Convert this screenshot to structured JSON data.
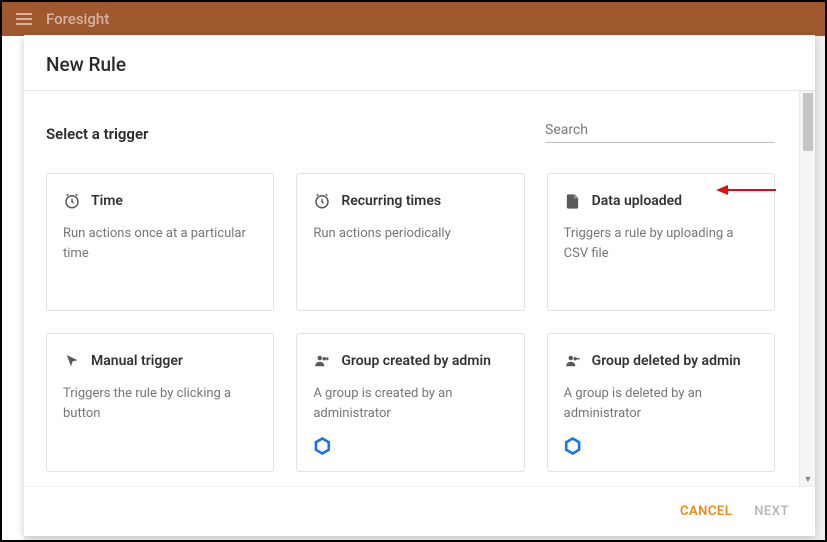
{
  "brand": "Foresight",
  "modal": {
    "title": "New Rule",
    "subheader": "Select a trigger",
    "search_placeholder": "Search"
  },
  "triggers": [
    {
      "title": "Time",
      "desc": "Run actions once at a particular time",
      "icon": "clock-icon"
    },
    {
      "title": "Recurring times",
      "desc": "Run actions periodically",
      "icon": "clock-icon"
    },
    {
      "title": "Data uploaded",
      "desc": "Triggers a rule by uploading a CSV file",
      "icon": "file-icon",
      "highlighted": true
    },
    {
      "title": "Manual trigger",
      "desc": "Triggers the rule by clicking a button",
      "icon": "cursor-icon"
    },
    {
      "title": "Group created by admin",
      "desc": "A group is created by an administrator",
      "icon": "group-add-icon",
      "badge": true
    },
    {
      "title": "Group deleted by admin",
      "desc": "A group is deleted by an administrator",
      "icon": "group-remove-icon",
      "badge": true
    }
  ],
  "footer": {
    "cancel": "CANCEL",
    "next": "NEXT"
  }
}
